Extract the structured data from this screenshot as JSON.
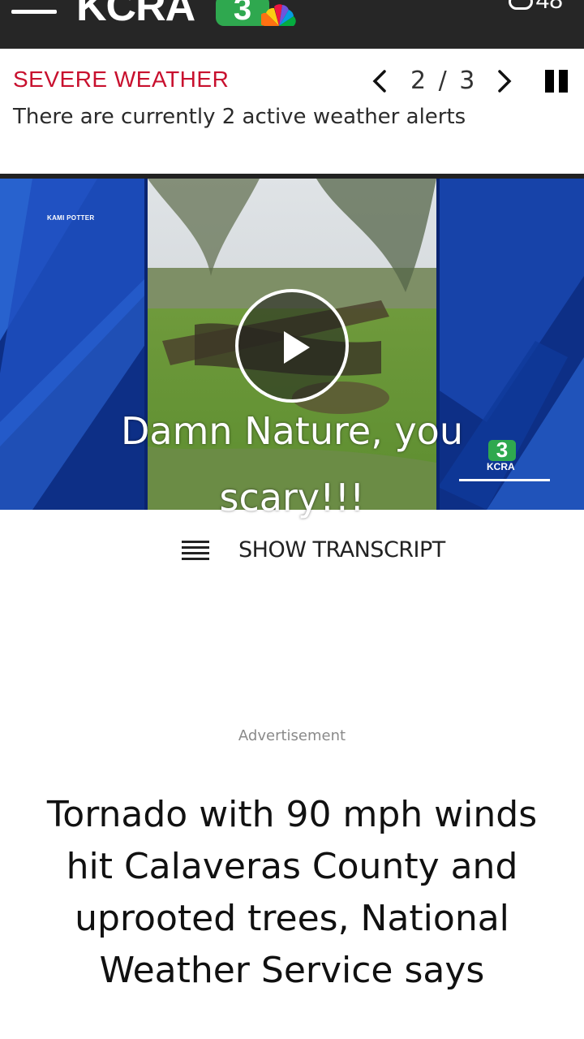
{
  "header": {
    "logo_text": "KCRA",
    "logo_channel": "3",
    "temperature": "48"
  },
  "alert": {
    "title": "SEVERE WEATHER",
    "message": "There are currently 2 active weather alerts",
    "pager_count": "2 / 3"
  },
  "video": {
    "name_tag": "KAMI POTTER",
    "bug_channel": "3",
    "bug_text": "KCRA"
  },
  "caption": "Damn Nature, you scary!!!",
  "transcript": {
    "label": "SHOW TRANSCRIPT"
  },
  "advertisement_label": "Advertisement",
  "headline": "Tornado with 90 mph winds hit Calaveras County and uprooted trees, National Weather Service says",
  "colors": {
    "header_bg": "#262626",
    "alert_red": "#c8102e",
    "brand_green": "#2fa84f",
    "video_blue": "#0d2f86"
  },
  "icons": [
    "menu-icon",
    "peacock-icon",
    "cloud-icon",
    "chevron-left-icon",
    "chevron-right-icon",
    "pause-icon",
    "play-icon",
    "list-icon"
  ]
}
